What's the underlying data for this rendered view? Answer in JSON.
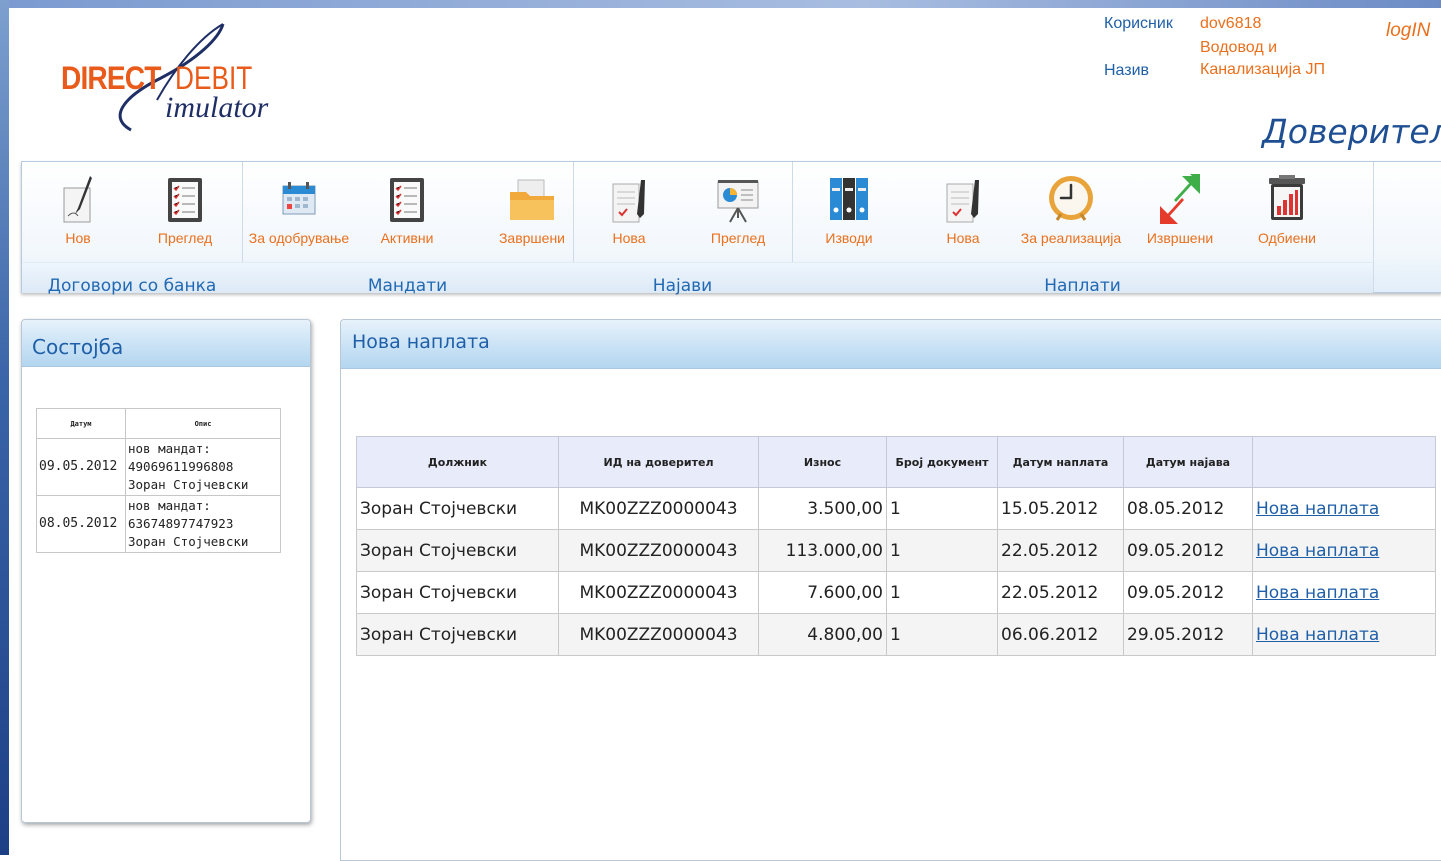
{
  "logo": {
    "word1": "DIRECT",
    "word2": "DEBIT",
    "word3": "imulator"
  },
  "user": {
    "user_label": "Корисник",
    "user_value": "dov6818",
    "name_label": "Назив",
    "name_line1": "Водовод и",
    "name_line2": "Канализација ЈП",
    "login": "logIN"
  },
  "role_title": "Доверител",
  "toolbar": {
    "groups": [
      {
        "label": "Договори со банка",
        "items": [
          {
            "label": "Нов",
            "icon": "pen-document-icon"
          },
          {
            "label": "Преглед",
            "icon": "checklist-icon"
          }
        ]
      },
      {
        "label": "Мандати",
        "items": [
          {
            "label": "За одобрување",
            "icon": "calendar-icon"
          },
          {
            "label": "Активни",
            "icon": "checklist-icon"
          },
          {
            "label": "Завршени",
            "icon": "folder-icon"
          }
        ]
      },
      {
        "label": "Најави",
        "items": [
          {
            "label": "Нова",
            "icon": "document-pen-icon"
          },
          {
            "label": "Преглед",
            "icon": "presentation-board-icon"
          }
        ]
      },
      {
        "label": "Наплати",
        "items": [
          {
            "label": "Изводи",
            "icon": "binders-icon"
          },
          {
            "label": "Нова",
            "icon": "document-pen-icon"
          },
          {
            "label": "За реализација",
            "icon": "clock-icon"
          },
          {
            "label": "Извршени",
            "icon": "arrows-icon"
          },
          {
            "label": "Одбиени",
            "icon": "bar-chart-bin-icon"
          }
        ]
      }
    ]
  },
  "status_panel": {
    "title": "Состојба",
    "headers": [
      "Датум",
      "Опис"
    ],
    "rows": [
      {
        "date": "09.05.2012",
        "desc": "нов мандат:\n49069611996808\nЗоран Стојчевски"
      },
      {
        "date": "08.05.2012",
        "desc": "нов мандат:\n63674897747923\nЗоран Стојчевски"
      }
    ]
  },
  "main_panel": {
    "title": "Нова наплата",
    "headers": [
      "Должник",
      "ИД на доверител",
      "Износ",
      "Број документ",
      "Датум наплата",
      "Датум најава",
      ""
    ],
    "rows": [
      [
        "Зоран Стојчевски",
        "MK00ZZZ0000043",
        "3.500,00",
        "1",
        "15.05.2012",
        "08.05.2012",
        "Нова наплата"
      ],
      [
        "Зоран Стојчевски",
        "MK00ZZZ0000043",
        "113.000,00",
        "1",
        "22.05.2012",
        "09.05.2012",
        "Нова наплата"
      ],
      [
        "Зоран Стојчевски",
        "MK00ZZZ0000043",
        "7.600,00",
        "1",
        "22.05.2012",
        "09.05.2012",
        "Нова наплата"
      ],
      [
        "Зоран Стојчевски",
        "MK00ZZZ0000043",
        "4.800,00",
        "1",
        "06.06.2012",
        "29.05.2012",
        "Нова наплата"
      ]
    ]
  }
}
